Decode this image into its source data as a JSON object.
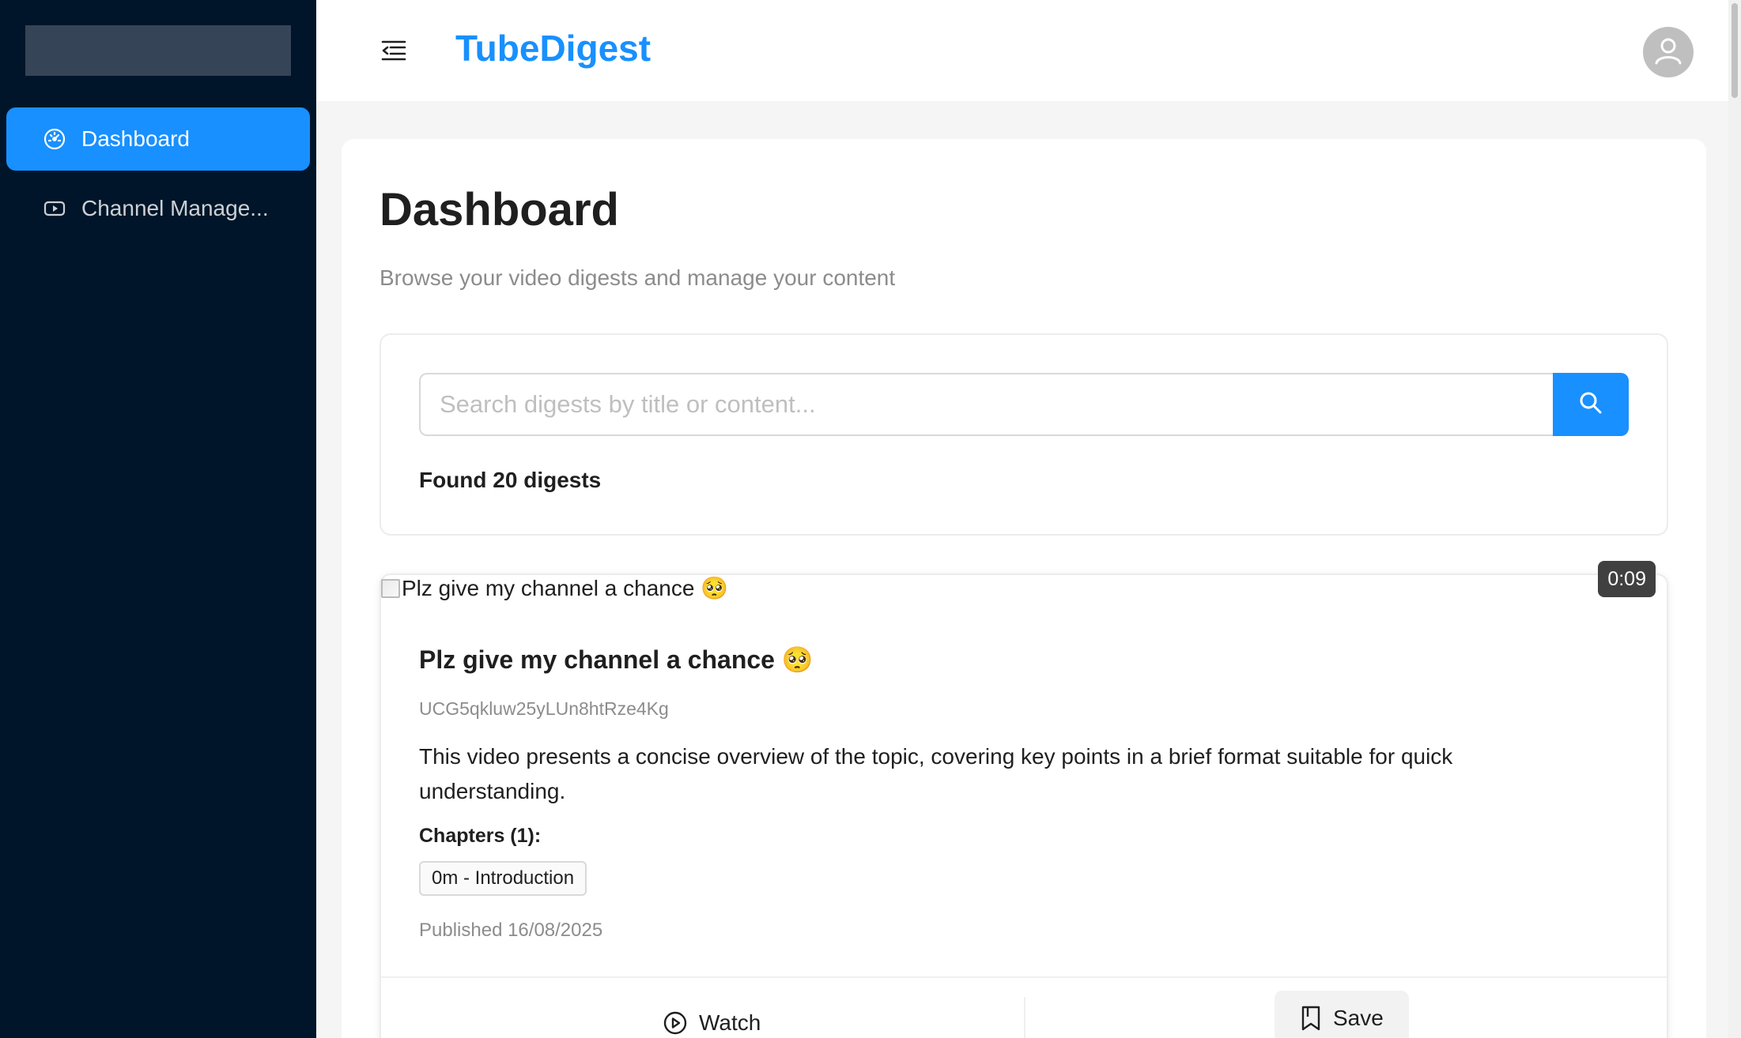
{
  "sidebar": {
    "items": [
      {
        "label": "Dashboard",
        "icon": "dashboard-icon",
        "active": true
      },
      {
        "label": "Channel Manage...",
        "icon": "youtube-icon",
        "active": false
      }
    ]
  },
  "header": {
    "brand": "TubeDigest",
    "menu_icon": "menu-fold-icon",
    "avatar_icon": "user-icon"
  },
  "main": {
    "title": "Dashboard",
    "subtitle": "Browse your video digests and manage your content",
    "search": {
      "placeholder": "Search digests by title or content...",
      "value": "",
      "button_icon": "search-icon"
    },
    "found_text": "Found 20 digests"
  },
  "digest": {
    "thumbnail_alt": "Plz give my channel a chance 🥺",
    "duration": "0:09",
    "title": "Plz give my channel a chance 🥺",
    "channel_id": "UCG5qkluw25yLUn8htRze4Kg",
    "summary": "This video presents a concise overview of the topic, covering key points in a brief format suitable for quick understanding.",
    "chapters_label": "Chapters (1):",
    "chapters": [
      "0m - Introduction"
    ],
    "published": "Published 16/08/2025",
    "actions": {
      "watch": "Watch",
      "save": "Save"
    }
  },
  "colors": {
    "sidebar_bg": "#001529",
    "accent": "#1890ff",
    "page_bg": "#f5f5f5"
  }
}
